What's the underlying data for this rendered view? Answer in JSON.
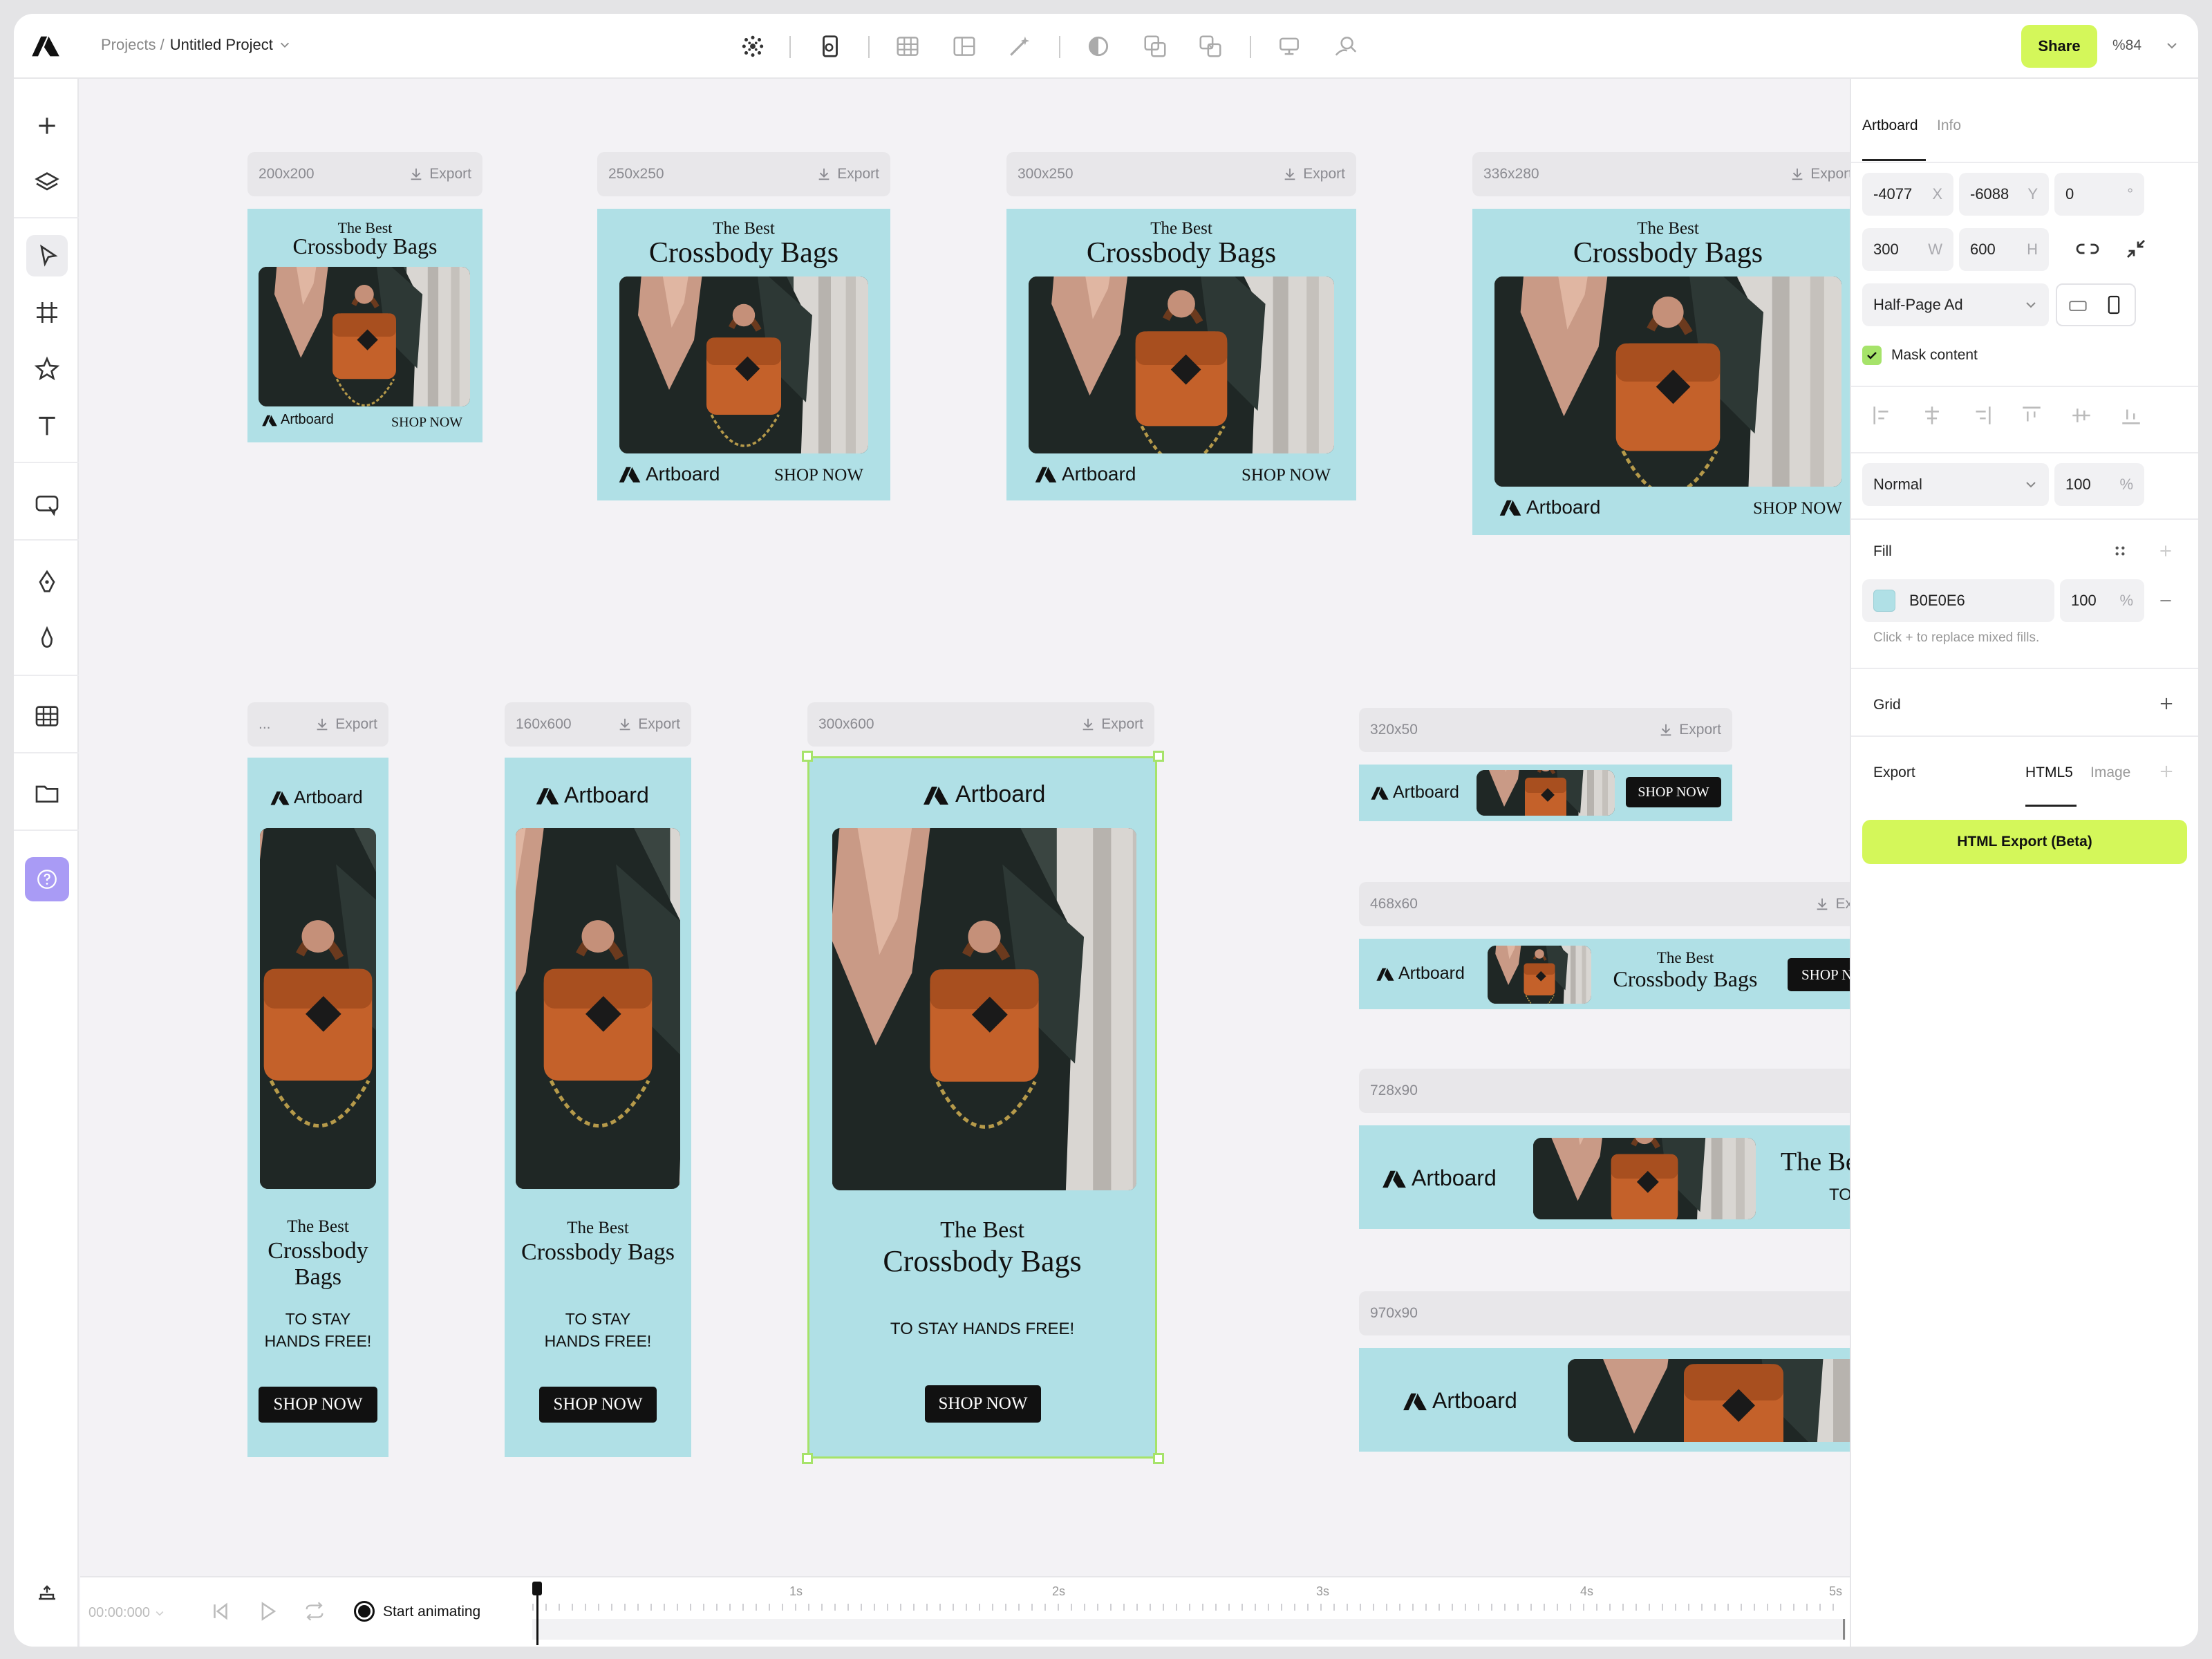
{
  "app": {
    "breadcrumb_root": "Projects /",
    "project_name": "Untitled Project",
    "share_label": "Share",
    "zoom": "%84"
  },
  "colors": {
    "accent": "#D4F75A",
    "ad_bg": "#B0E0E6",
    "selection": "#A6E36A",
    "help": "#A99BF5"
  },
  "toolbar": [
    "grid-dots-icon",
    "mobile-touch-icon",
    "table-icon",
    "layout-icon",
    "magic-wand-icon",
    "contrast-icon",
    "shapes-icon",
    "layers-copy-icon",
    "component-icon",
    "search-person-icon"
  ],
  "leftbar": [
    "plus-icon",
    "layers-icon",
    "pointer-icon",
    "frame-icon",
    "star-icon",
    "text-icon",
    "comment-icon",
    "pen-icon",
    "dropper-icon",
    "table-icon",
    "folder-icon",
    "help-icon"
  ],
  "export_label": "Export",
  "ads": {
    "a200": {
      "size": "200x200",
      "kicker": "The Best",
      "title": "Crossbody Bags",
      "brand": "Artboard",
      "shop": "SHOP NOW"
    },
    "a250": {
      "size": "250x250",
      "kicker": "The Best",
      "title": "Crossbody Bags",
      "brand": "Artboard",
      "shop": "SHOP NOW"
    },
    "a300": {
      "size": "300x250",
      "kicker": "The Best",
      "title": "Crossbody Bags",
      "brand": "Artboard",
      "shop": "SHOP NOW"
    },
    "a336": {
      "size": "336x280",
      "kicker": "The Best",
      "title": "Crossbody Bags",
      "brand": "Artboard",
      "shop": "SHOP NOW"
    },
    "s120": {
      "size": "...",
      "brand": "Artboard",
      "kicker": "The Best",
      "title1": "Crossbody",
      "title2": "Bags",
      "sub1": "TO STAY",
      "sub2": "HANDS FREE!",
      "shop": "SHOP NOW"
    },
    "s160": {
      "size": "160x600",
      "brand": "Artboard",
      "kicker": "The Best",
      "title": "Crossbody Bags",
      "sub1": "TO STAY",
      "sub2": "HANDS FREE!",
      "shop": "SHOP NOW"
    },
    "h300": {
      "size": "300x600",
      "brand": "Artboard",
      "kicker": "The Best",
      "title": "Crossbody Bags",
      "sub": "TO STAY HANDS FREE!",
      "shop": "SHOP NOW"
    },
    "b320": {
      "size": "320x50",
      "brand": "Artboard",
      "shop": "SHOP NOW"
    },
    "b468": {
      "size": "468x60",
      "export": "Ex",
      "brand": "Artboard",
      "kicker": "The Best",
      "title": "Crossbody Bags",
      "shop": "SHOP NO"
    },
    "b728": {
      "size": "728x90",
      "brand": "Artboard",
      "kicker": "The Bes",
      "sub": "TO S"
    },
    "b970": {
      "size": "970x90",
      "brand": "Artboard"
    }
  },
  "panel": {
    "tabs": [
      "Artboard",
      "Info"
    ],
    "x": "-4077",
    "x_unit": "X",
    "y": "-6088",
    "y_unit": "Y",
    "rot": "0",
    "rot_unit": "°",
    "w": "300",
    "w_unit": "W",
    "h": "600",
    "h_unit": "H",
    "preset": "Half-Page Ad",
    "mask_label": "Mask content",
    "blend": "Normal",
    "opacity": "100",
    "pct": "%",
    "fill_title": "Fill",
    "fill_hex": "B0E0E6",
    "fill_opacity": "100",
    "fill_hint": "Click + to replace mixed fills.",
    "grid_title": "Grid",
    "export_title": "Export",
    "export_tabs": [
      "HTML5",
      "Image"
    ],
    "export_button": "HTML Export (Beta)"
  },
  "timeline": {
    "time": "00:00:000",
    "start_label": "Start animating",
    "marks": [
      "1s",
      "2s",
      "3s",
      "4s",
      "5s"
    ]
  }
}
